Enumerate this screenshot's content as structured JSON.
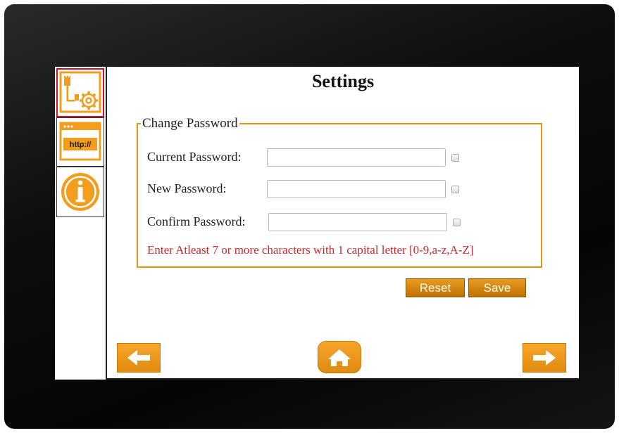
{
  "page": {
    "title": "Settings"
  },
  "sidebar": {
    "items": [
      {
        "name": "network-settings",
        "icon": "ethernet-gear-icon",
        "active": true
      },
      {
        "name": "http-settings",
        "icon": "browser-http-icon",
        "text": "http://",
        "active": false
      },
      {
        "name": "info",
        "icon": "info-icon",
        "active": false
      }
    ]
  },
  "change_password": {
    "legend": "Change Password",
    "fields": [
      {
        "label": "Current Password:",
        "value": ""
      },
      {
        "label": "New Password:",
        "value": ""
      },
      {
        "label": "Confirm Password:",
        "value": ""
      }
    ],
    "hint": "Enter Atleast 7 or more characters with 1 capital letter [0-9,a-z,A-Z]"
  },
  "buttons": {
    "reset": "Reset",
    "save": "Save"
  },
  "navigation": {
    "back_icon": "arrow-left-icon",
    "home_icon": "home-icon",
    "next_icon": "arrow-right-icon"
  },
  "colors": {
    "accent": "#F29D1C",
    "warning_text": "#D0262A",
    "active_border": "#C8102E"
  }
}
